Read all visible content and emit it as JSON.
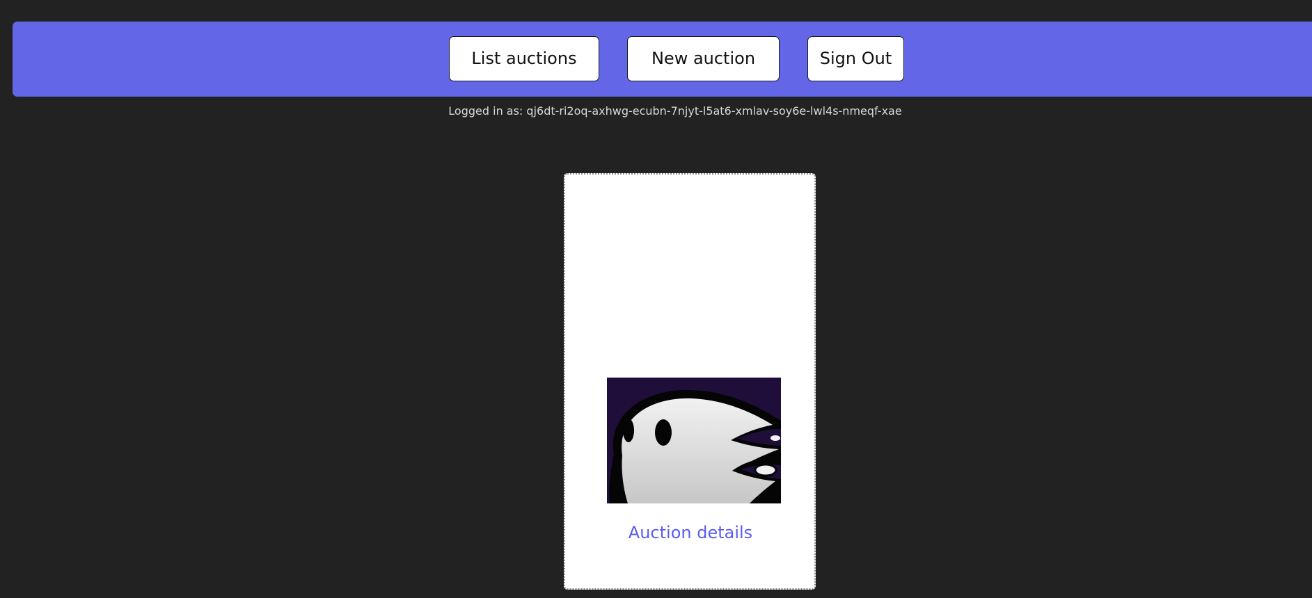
{
  "nav": {
    "list_auctions_label": "List auctions",
    "new_auction_label": "New auction",
    "sign_out_label": "Sign Out"
  },
  "session": {
    "logged_in_text": "Logged in as: qj6dt-ri2oq-axhwg-ecubn-7njyt-l5at6-xmlav-soy6e-lwl4s-nmeqf-xae"
  },
  "auctions": [
    {
      "image_icon": "ghost-image",
      "link_label": "Auction details"
    }
  ],
  "colors": {
    "page_background": "#222222",
    "navbar_background": "#6366e6",
    "link_color": "#5b5cf0",
    "image_background": "#1f0e3a"
  }
}
